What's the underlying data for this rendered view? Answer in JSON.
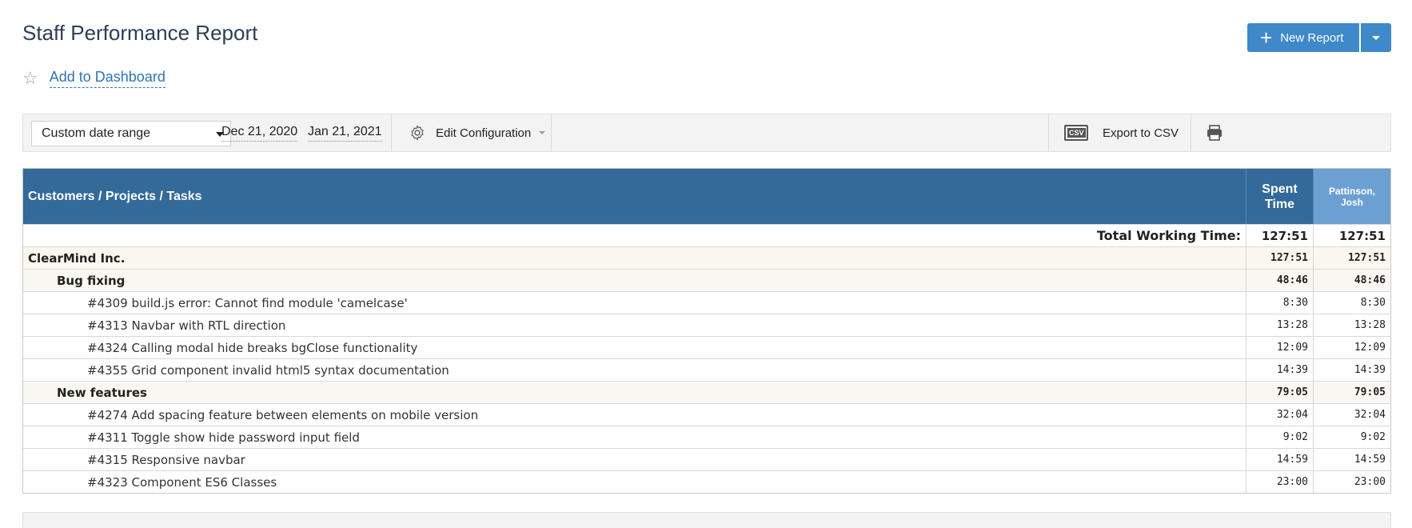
{
  "header": {
    "title": "Staff Performance Report",
    "favorite_label": "Add to Dashboard",
    "new_report_label": "New Report"
  },
  "toolbar": {
    "date_range_select": "Custom date range",
    "date_from": "Dec 21, 2020",
    "date_separator": "-",
    "date_to": "Jan 21, 2021",
    "edit_config_label": "Edit Configuration",
    "export_label": "Export to CSV",
    "csv_badge": "CSV"
  },
  "table": {
    "col_tasks": "Customers / Projects / Tasks",
    "col_spent": "Spent\nTime",
    "col_user": "Pattinson,\nJosh",
    "total_label": "Total Working Time:",
    "total_spent": "127:51",
    "total_user": "127:51",
    "customer": {
      "name": "ClearMind Inc.",
      "spent": "127:51",
      "user": "127:51"
    },
    "projects": [
      {
        "name": "Bug fixing",
        "spent": "48:46",
        "user": "48:46",
        "tasks": [
          {
            "name": "#4309 build.js error: Cannot find module 'camelcase'",
            "spent": "8:30",
            "user": "8:30"
          },
          {
            "name": "#4313 Navbar with RTL direction",
            "spent": "13:28",
            "user": "13:28"
          },
          {
            "name": "#4324 Calling modal hide breaks bgClose functionality",
            "spent": "12:09",
            "user": "12:09"
          },
          {
            "name": "#4355 Grid component invalid html5 syntax documentation",
            "spent": "14:39",
            "user": "14:39"
          }
        ]
      },
      {
        "name": "New features",
        "spent": "79:05",
        "user": "79:05",
        "tasks": [
          {
            "name": "#4274 Add spacing feature between elements on mobile version",
            "spent": "32:04",
            "user": "32:04"
          },
          {
            "name": "#4311 Toggle show hide password input field",
            "spent": "9:02",
            "user": "9:02"
          },
          {
            "name": "#4315 Responsive navbar",
            "spent": "14:59",
            "user": "14:59"
          },
          {
            "name": "#4323 Component ES6 Classes",
            "spent": "23:00",
            "user": "23:00"
          }
        ]
      }
    ]
  },
  "colors": {
    "header_bg": "#336a99",
    "user_col_bg": "#6da0d2",
    "button_bg": "#3f88c9",
    "link": "#2f73b8"
  },
  "icons": {
    "favorite": "star-icon",
    "new_report": "plus-icon",
    "dropdown": "chevron-down-icon",
    "config": "gear-icon",
    "export": "csv-icon",
    "print": "printer-icon"
  }
}
